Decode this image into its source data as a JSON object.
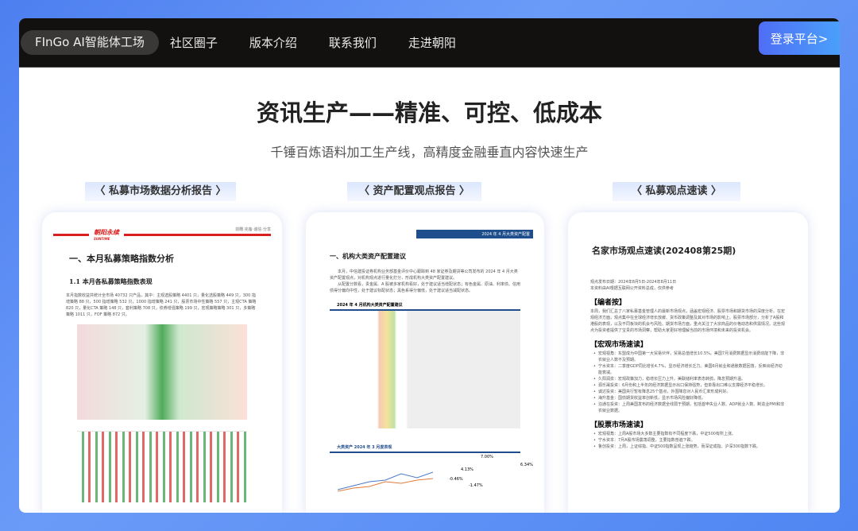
{
  "nav": {
    "brand": "FInGo AI智能体工场",
    "items": [
      "社区圈子",
      "版本介绍",
      "联系我们",
      "走进朝阳"
    ],
    "login": "登录平台>"
  },
  "hero": {
    "title": "资讯生产——精准、可控、低成本",
    "subtitle": "千锤百炼语料加工生产线，高精度金融垂直内容快速生产"
  },
  "tabs": [
    "〈 私募市场数据分析报告 〉",
    "〈 资产配置观点报告 〉",
    "〈 私募观点速读 〉"
  ],
  "card1": {
    "logo": "朝阳永续",
    "logo_sub": "SUNTIME",
    "motto": "前瞻·完备·诚信·分享",
    "h1": "一、本月私募策略指数分析",
    "h2": "1.1 本月各私募策略指数表现",
    "p": "本月指数收益共统计全市场 40732 只产品，其中：主观选股策略 4401 只，量化选股策略 449 只，300 指增策略 88 只，500 指增策略 532 只，1000 指增策略 241 只，股票市场中性策略 557 只，主观CTA 策略 820 只，量化CTA 策略 148 只，套利策略 708 只，债券增强策略 199 只，宏观策略策略 301 只，多策略策略 1011 只，FOF 策略 872 只。"
  },
  "card2": {
    "banner": "2024 年 4 月大类资产配置",
    "h1": "一、机构大类资产配置建议",
    "p1": "本月，中信建投证券机构业务部基金评价中心跟踪到 48 家证券及期货等公司发布的 2024 年 4 月大类资产配置观点，对机构观点进行量化打分，形成机构大类资产配置建议。",
    "p2": "从配置分数看，贵金属、A 股被多家机构看好，处于建议适当增配状态；有色金属、原油、利率债、信用债得分偏向中性，处于建议标配状态；黑色系得分偏低，处于建议适当减配状态。",
    "table_title": "2024 年 4 月机构大类资产配置建议",
    "chart_title": "大类资产 2024 年 3 月度表现",
    "labels": [
      "7.00%",
      "6.34%",
      "4.13%",
      "-0.46%",
      "-1.47%"
    ]
  },
  "card3": {
    "title": "名家市场观点速读(202408第25期)",
    "date": "观点发布日期：2024年8月5日-2024年8月11日",
    "source": "本资料由AI根据互联网公开资料总成，仅供参考",
    "s1": "【编者按】",
    "s1p": "本周，我们汇总了八家私募基金管理人的最新市场观点，涵盖宏观经济、股票市场和期货市场的深度分析。在宏观经济方面，观点集中在全球经济增长放缓、货币政策调整及其对市场的影响上。股票市场部分，分析了A股和港股的表现，以及不同板块的机会与风险。期货市场方面，重点关注了大宗商品的价格动态和供需情况。这些观点为投资者提供了宝贵的市场洞察，帮助大家更好地理解当前的市场环境和未来的投资机会。",
    "s2": "【宏观市场速读】",
    "s2items": [
      "宏观视角：东盟成为中国第一大贸易伙伴，贸易总值增长10.5%。美国7月消费数据显示消费动能下降，非农就业人数不及预期。",
      "宁水资本：二季度GDP同比增长4.7%，显示经济增长乏力。美国6月就业和通胀数据回落，反映出经济动能衰减。",
      "久阳润泉：宏观政策加力，稳增长压力上升。美联储利率表态转鸽，降息预期升温。",
      "源乐晟投资：6月份和上半年的经济数据显示出口保持强势，但单靠出口难以支撑经济平稳增长。",
      "诚达投资：美国央行暂有降息25个基点，外围降息对人民币汇率形成利好。",
      "海升基金：国债期货收益率创新低，显示市场风险偏好降低。",
      "泊通在投资：上周美国发布的经济数据全线弱于预期，包括首申失业人数、ADP就业人数、制造业PMI和非农就业数据。"
    ],
    "s3": "【股票市场速读】",
    "s3items": [
      "宏观视角：上周A股市场大多数主要指数有不同程度下跌，中证500有所上涨。",
      "宁水资本：7月A股市场震荡调整，主要指数普遍下跌。",
      "鲁创投资：上周，上证综指、中证500指数呈现上涨趋势，而深证成指、沪深300指数下跌。"
    ]
  },
  "colors": {
    "accent": "#4f6df5",
    "nav_bg": "#121110",
    "brand_red": "#d9201e",
    "doc_blue": "#1f4e8c"
  }
}
